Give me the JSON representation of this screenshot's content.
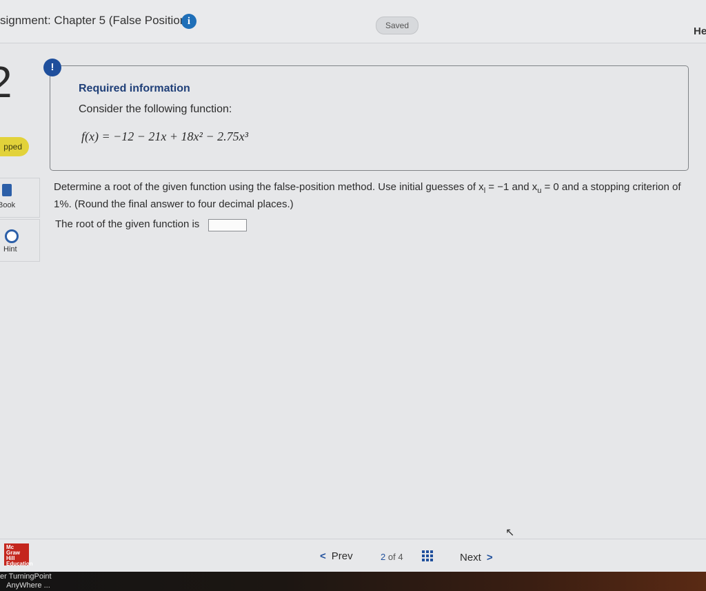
{
  "header": {
    "assignment_title": "signment: Chapter 5 (False Position)",
    "saved_label": "Saved",
    "help_label": "He"
  },
  "left_rail": {
    "question_number": "2",
    "status_badge": "pped",
    "ebook_label": "Book",
    "hint_label": "Hint"
  },
  "required_info": {
    "alert_glyph": "!",
    "title": "Required information",
    "consider_text": "Consider the following function:",
    "function": "f(x) = −12 − 21x + 18x² − 2.75x³"
  },
  "question": {
    "text_part1": "Determine a root of the given function using the false-position method. Use initial guesses of x",
    "sub1": "l",
    "text_part2": " = −1 and x",
    "sub2": "u",
    "text_part3": " = 0 and a stopping criterion of 1%. (Round the final answer to four decimal places.)",
    "answer_label": "The root of the given function is",
    "answer_value": ""
  },
  "footer": {
    "logo_text": "Mc Graw Hill Education",
    "prev_label": "Prev",
    "page_current": "2",
    "page_of": "of",
    "page_total": "4",
    "next_label": "Next"
  },
  "taskbar": {
    "label_line1": "er TurningPoint",
    "label_line2": "AnyWhere ..."
  },
  "colors": {
    "accent": "#1f4f9c",
    "status_badge": "#e2d23a",
    "logo_red": "#c4261d"
  },
  "icons": [
    "info-icon",
    "alert-icon",
    "book-icon",
    "lifebuoy-icon",
    "chevron-left-icon",
    "grid-icon",
    "chevron-right-icon",
    "cursor-icon"
  ]
}
